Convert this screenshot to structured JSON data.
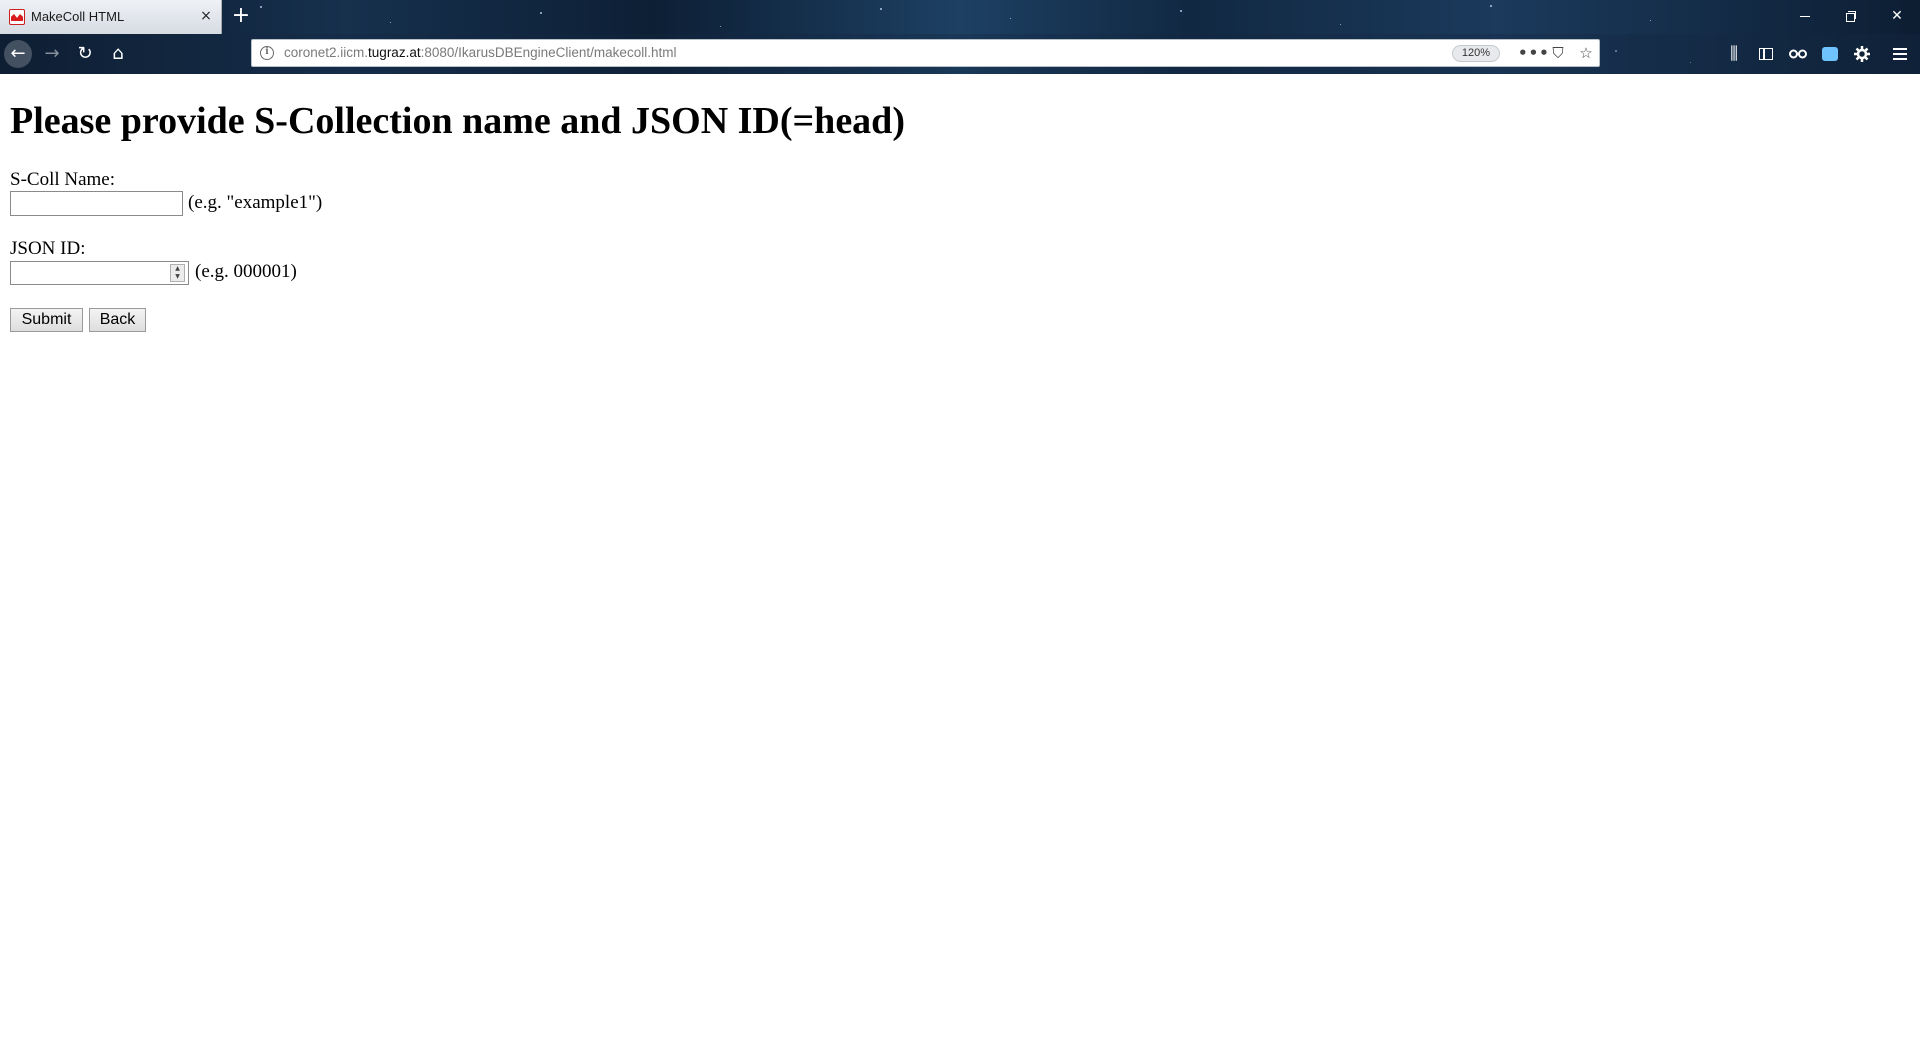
{
  "browser": {
    "tab": {
      "title": "MakeColl HTML",
      "close_glyph": "×",
      "favicon": "red-crown-favicon"
    },
    "new_tab_glyph": "+",
    "window_controls": {
      "minimize": "minimize-icon",
      "restore": "restore-icon",
      "close_glyph": "✕"
    },
    "nav": {
      "back_glyph": "←",
      "forward_glyph": "→",
      "reload_glyph": "↻",
      "home_glyph": "⌂"
    },
    "url": {
      "prefix": "coronet2.iicm.",
      "host": "tugraz.at",
      "suffix": ":8080/IkarusDBEngineClient/makecoll.html",
      "info_glyph": "i",
      "zoom": "120%"
    },
    "url_actions": {
      "more_glyph": "•••",
      "pocket_glyph": "⛉",
      "star_glyph": "☆"
    },
    "toolbar": {
      "library_glyph": "⫼"
    },
    "accent_color": "#1d4063"
  },
  "page": {
    "title": "Please provide S-Collection name and JSON ID(=head)",
    "scoll": {
      "label": "S-Coll Name:",
      "value": "",
      "hint": "(e.g. \"example1\")"
    },
    "json": {
      "label": "JSON ID:",
      "value": "",
      "hint": "(e.g. 000001)"
    },
    "buttons": {
      "submit": "Submit",
      "back": "Back"
    }
  }
}
